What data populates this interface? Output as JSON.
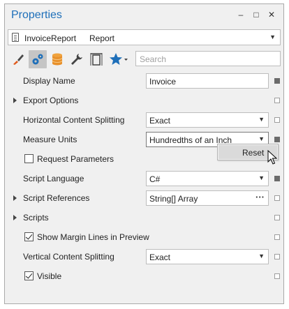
{
  "window": {
    "title": "Properties",
    "minimize_glyph": "–",
    "maximize_glyph": "□",
    "close_glyph": "✕"
  },
  "object_selector": {
    "name": "InvoiceReport",
    "type": "Report"
  },
  "toolbar": {
    "tabs": [
      "brush-icon",
      "gears-icon",
      "database-icon",
      "wrench-icon",
      "page-layout-icon",
      "star-icon"
    ],
    "active_tab": "gears-icon",
    "search_placeholder": "Search"
  },
  "properties": [
    {
      "label": "Display Name",
      "kind": "text",
      "value": "Invoice",
      "modified": true
    },
    {
      "label": "Export Options",
      "kind": "category",
      "modified": false
    },
    {
      "label": "Horizontal Content Splitting",
      "kind": "dropdown",
      "value": "Exact",
      "modified": false
    },
    {
      "label": "Measure Units",
      "kind": "dropdown",
      "value": "Hundredths of an Inch",
      "modified": true
    },
    {
      "label": "Request Parameters",
      "kind": "checkbox",
      "checked": false,
      "modified": false
    },
    {
      "label": "Script Language",
      "kind": "dropdown",
      "value": "C#",
      "modified": true
    },
    {
      "label": "Script References",
      "kind": "ellipsis",
      "value": "String[] Array",
      "modified": false
    },
    {
      "label": "Scripts",
      "kind": "category",
      "modified": false
    },
    {
      "label": "Show Margin Lines in Preview",
      "kind": "checkbox",
      "checked": true,
      "modified": false
    },
    {
      "label": "Vertical Content Splitting",
      "kind": "dropdown",
      "value": "Exact",
      "modified": false
    },
    {
      "label": "Visible",
      "kind": "checkbox",
      "checked": true,
      "modified": false
    }
  ],
  "context_menu": {
    "items": [
      "Reset"
    ]
  },
  "colors": {
    "title": "#1e6fb9",
    "panel_bg": "#f0f0f0",
    "marker_set": "#6b6b6b"
  }
}
